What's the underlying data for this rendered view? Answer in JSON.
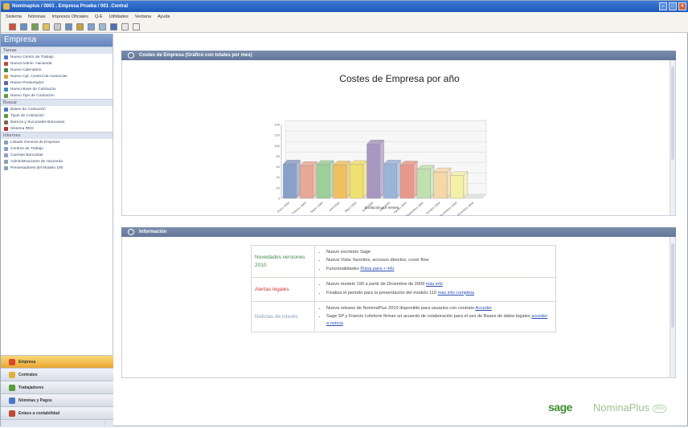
{
  "window": {
    "title": "Nominaplus / 0001 . Empresa Prueba / 001 .Central"
  },
  "menu": [
    "Sistema",
    "Nóminas",
    "Impresos Oficiales",
    "Q-E",
    "Utilidades",
    "Ventana",
    "Ayuda"
  ],
  "sidebar": {
    "header": "Empresa",
    "sections": [
      {
        "title": "Tareas",
        "items": [
          {
            "label": "Nuevo Centro de Trabajo",
            "color": "#4a78c4"
          },
          {
            "label": "Nueva Admin. Hacienda",
            "color": "#c04a3a"
          },
          {
            "label": "Nuevo Calendario",
            "color": "#3a8c4a"
          },
          {
            "label": "Nuevo Cpt. Control de Ausencias",
            "color": "#d9a030"
          },
          {
            "label": "Nuevo Presentador",
            "color": "#6a5cb0"
          },
          {
            "label": "Nuevo Base de Cotización",
            "color": "#3a8cc0"
          },
          {
            "label": "Nuevo Tipo de Cotización",
            "color": "#5a9c3a"
          }
        ]
      },
      {
        "title": "Buscar",
        "items": [
          {
            "label": "Bases de Cotización",
            "color": "#4a78c4"
          },
          {
            "label": "Tipos de Cotización",
            "color": "#5a9c3a"
          },
          {
            "label": "Bancos y Sucursales Bancarias",
            "color": "#7a6a4a"
          },
          {
            "label": "Sistema RED",
            "color": "#c03030"
          }
        ]
      },
      {
        "title": "Informes",
        "items": [
          {
            "label": "Listado General de Empresa",
            "color": "#8aa0c0"
          },
          {
            "label": "Centros de Trabajo",
            "color": "#8aa0c0"
          },
          {
            "label": "Cuentas Bancarias",
            "color": "#8aa0c0"
          },
          {
            "label": "Administraciones de Hacienda",
            "color": "#8aa0c0"
          },
          {
            "label": "Presentadores del Modelo 190",
            "color": "#8aa0c0"
          }
        ]
      }
    ],
    "nav": [
      {
        "label": "Empresa",
        "active": true,
        "color": "#d9472b"
      },
      {
        "label": "Contratos",
        "active": false,
        "color": "#e0b040"
      },
      {
        "label": "Trabajadores",
        "active": false,
        "color": "#5a9c3a"
      },
      {
        "label": "Nóminas y Pagos",
        "active": false,
        "color": "#4a78c4"
      },
      {
        "label": "Enlace a contabilidad",
        "active": false,
        "color": "#c04a3a"
      }
    ]
  },
  "chart_panel": {
    "header": "Costes de Empresa (Gráfico con totales por mes)"
  },
  "chart_data": {
    "type": "bar",
    "title": "Costes de Empresa por año",
    "xlabel": "Evolución por meses",
    "ylabel": "",
    "categories": [
      "Enero 2009",
      "Febrero 2009",
      "Marzo 2009",
      "Abril 2009",
      "Mayo 2009",
      "Junio 2009",
      "Julio 2009",
      "Agosto 2009",
      "Septiembre 2009",
      "Octubre 2009",
      "Noviembre 2009",
      "Diciembre 2009"
    ],
    "values": [
      65,
      62,
      64,
      63,
      64,
      103,
      65,
      63,
      55,
      50,
      43,
      0
    ],
    "colors": [
      "#8aa0c8",
      "#e8a898",
      "#9ccf9a",
      "#f0c060",
      "#f0e070",
      "#a898c0",
      "#9cb4d8",
      "#e8988a",
      "#c0e0b0",
      "#f4d8a8",
      "#f4f0a8",
      "#cccccc"
    ],
    "ytick_labels": [
      "0",
      "20",
      "40",
      "60",
      "80",
      "100",
      "120",
      "140"
    ],
    "ylim": [
      0,
      140
    ],
    "grid": true
  },
  "info_panel": {
    "header": "Información",
    "rows": [
      {
        "category": "Novedades versiones 2010",
        "color": "#3f8a4c",
        "items": [
          {
            "text": "Nuevo escritorio Sage",
            "link": ""
          },
          {
            "text": "Nueva Vista: favoritos, accesos directos, cover flow",
            "link": ""
          },
          {
            "text": "Funcionalidades",
            "link": "Pulsa para + info"
          }
        ]
      },
      {
        "category": "Alertas legales",
        "color": "#d03a2a",
        "items": [
          {
            "text": "Nuevo modelo 190 a partir de Diciembre de 2009",
            "link": "más info"
          },
          {
            "text": "Finaliza el periodo para la presentación del modelo 110",
            "link": "más info completa"
          }
        ]
      },
      {
        "category": "Noticias de interés",
        "color": "#8b9bb7",
        "items": [
          {
            "text": "Nueva release de NominaPlus 2010 disponible para usuarios con contrato",
            "link": "Acceder"
          },
          {
            "text": "Sage SP y Francis Lefebvre firman un acuerdo de colaboración para el uso de Bases de datos legales",
            "link": "acceder a noticia"
          }
        ]
      }
    ]
  },
  "brand": {
    "sage": "sage",
    "product": "NominaPlus",
    "badge": "2010"
  }
}
